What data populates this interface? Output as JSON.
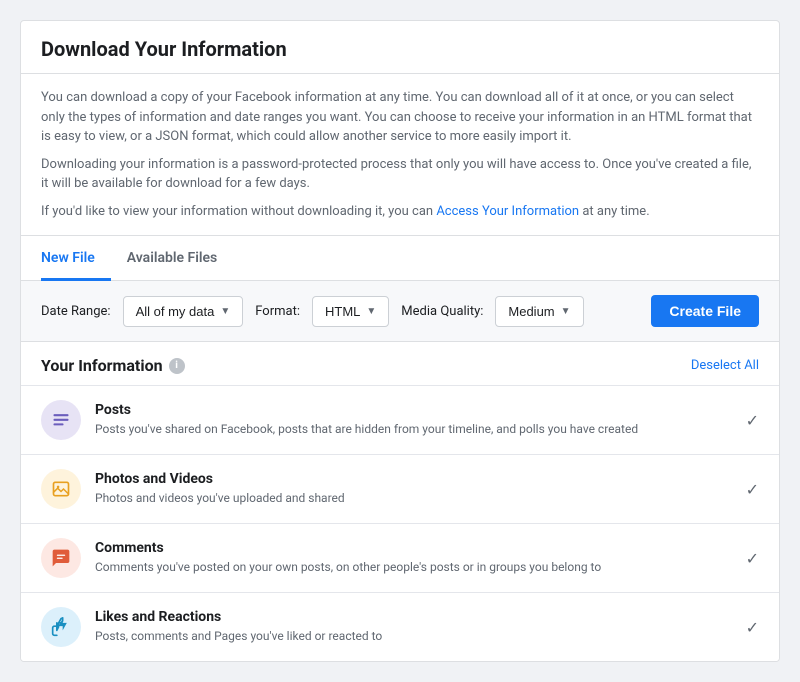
{
  "page": {
    "title": "Download Your Information"
  },
  "info_paragraphs": [
    "You can download a copy of your Facebook information at any time. You can download all of it at once, or you can select only the types of information and date ranges you want. You can choose to receive your information in an HTML format that is easy to view, or a JSON format, which could allow another service to more easily import it.",
    "Downloading your information is a password-protected process that only you will have access to. Once you've created a file, it will be available for download for a few days.",
    "If you'd like to view your information without downloading it, you can"
  ],
  "access_link_text": "Access Your Information",
  "access_link_suffix": " at any time.",
  "tabs": [
    {
      "label": "New File",
      "active": true
    },
    {
      "label": "Available Files",
      "active": false
    }
  ],
  "controls": {
    "date_range_label": "Date Range:",
    "date_range_value": "All of my data",
    "format_label": "Format:",
    "format_value": "HTML",
    "media_quality_label": "Media Quality:",
    "media_quality_value": "Medium",
    "create_button": "Create File"
  },
  "your_information": {
    "title": "Your Information",
    "deselect_all": "Deselect All",
    "items": [
      {
        "id": "posts",
        "icon_type": "posts",
        "icon_char": "☰",
        "title": "Posts",
        "description": "Posts you've shared on Facebook, posts that are hidden from your timeline, and polls you have created",
        "checked": true
      },
      {
        "id": "photos",
        "icon_type": "photos",
        "icon_char": "▶",
        "title": "Photos and Videos",
        "description": "Photos and videos you've uploaded and shared",
        "checked": true
      },
      {
        "id": "comments",
        "icon_type": "comments",
        "icon_char": "💬",
        "title": "Comments",
        "description": "Comments you've posted on your own posts, on other people's posts or in groups you belong to",
        "checked": true
      },
      {
        "id": "likes",
        "icon_type": "likes",
        "icon_char": "👍",
        "title": "Likes and Reactions",
        "description": "Posts, comments and Pages you've liked or reacted to",
        "checked": true
      }
    ]
  }
}
